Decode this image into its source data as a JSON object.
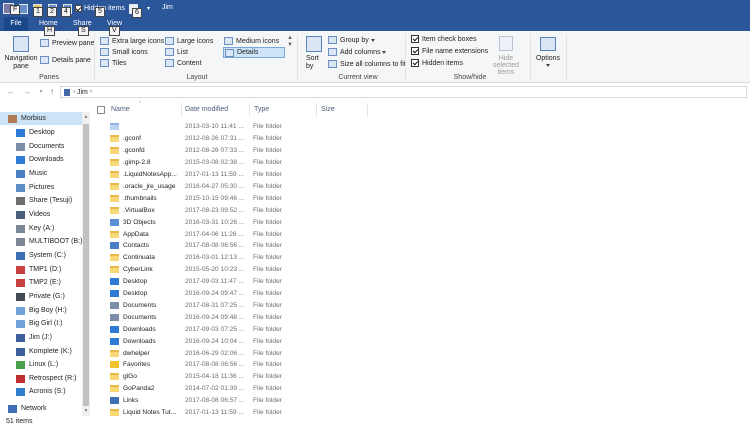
{
  "window": {
    "title": "Jim"
  },
  "quick_access": {
    "hidden_items_label": "Hidden items"
  },
  "keytips": {
    "file": "F",
    "qa1": "1",
    "qa2": "2",
    "qa4": "4",
    "qa5": "5",
    "qa6": "6",
    "home": "H",
    "share": "S",
    "view": "V"
  },
  "tabs": {
    "file": "File",
    "home": "Home",
    "share": "Share",
    "view": "View"
  },
  "ribbon": {
    "panes": {
      "label": "Panes",
      "navigation_pane": "Navigation pane",
      "preview_pane": "Preview pane",
      "details_pane": "Details pane"
    },
    "layout": {
      "label": "Layout",
      "extra_large_icons": "Extra large icons",
      "large_icons": "Large icons",
      "medium_icons": "Medium icons",
      "small_icons": "Small icons",
      "list": "List",
      "details": "Details",
      "tiles": "Tiles",
      "content": "Content"
    },
    "current_view": {
      "label": "Current view",
      "sort_by": "Sort by",
      "group_by": "Group by",
      "add_columns": "Add columns",
      "size_all_columns": "Size all columns to fit"
    },
    "show_hide": {
      "label": "Show/hide",
      "item_check_boxes": "Item check boxes",
      "file_name_extensions": "File name extensions",
      "hidden_items": "Hidden items",
      "hide_selected_items": "Hide selected items"
    },
    "options": {
      "label": "Options"
    }
  },
  "address": {
    "path": "Jim"
  },
  "navpane": {
    "items": [
      "Morbius",
      "Desktop",
      "Documents",
      "Downloads",
      "Music",
      "Pictures",
      "Share (Tesuji)",
      "Videos",
      "Key (A:)",
      "MULTIBOOT (B:)",
      "System (C:)",
      "TMP1 (D:)",
      "TMP2 (E:)",
      "Private (G:)",
      "Big Boy (H:)",
      "Big Girl (I:)",
      "Jim (J:)",
      "Komplete (K:)",
      "Linux (L:)",
      "Retrospect (R:)",
      "Acronis (S:)",
      "Network"
    ]
  },
  "columns": {
    "name": "Name",
    "date_modified": "Date modified",
    "type": "Type",
    "size": "Size"
  },
  "files": [
    {
      "name": "",
      "date": "2013-03-10 11:41 ...",
      "type": "File folder"
    },
    {
      "name": ".gconf",
      "date": "2012-08-26 07:31 ...",
      "type": "File folder"
    },
    {
      "name": ".gconfd",
      "date": "2012-08-26 07:33 ...",
      "type": "File folder"
    },
    {
      "name": ".gimp-2.8",
      "date": "2015-03-08 02:38 ...",
      "type": "File folder"
    },
    {
      "name": ".LiquidNotesApp...",
      "date": "2017-01-13 11:59 ...",
      "type": "File folder"
    },
    {
      "name": ".oracle_jre_usage",
      "date": "2016-04-27 05:30 ...",
      "type": "File folder"
    },
    {
      "name": ".thumbnails",
      "date": "2015-10-15 09:46 ...",
      "type": "File folder"
    },
    {
      "name": ".VirtualBox",
      "date": "2017-08-23 09:52 ...",
      "type": "File folder"
    },
    {
      "name": "3D Objects",
      "date": "2016-03-31 10:26 ...",
      "type": "File folder"
    },
    {
      "name": "AppData",
      "date": "2017-04-06 11:26 ...",
      "type": "File folder"
    },
    {
      "name": "Contacts",
      "date": "2017-08-08 06:56 ...",
      "type": "File folder"
    },
    {
      "name": "Continuata",
      "date": "2016-03-01 12:13 ...",
      "type": "File folder"
    },
    {
      "name": "CyberLink",
      "date": "2015-05-20 10:23 ...",
      "type": "File folder"
    },
    {
      "name": "Desktop",
      "date": "2017-09-03 11:47 ...",
      "type": "File folder"
    },
    {
      "name": "Desktop",
      "date": "2016-09-24 09:47 ...",
      "type": "File folder"
    },
    {
      "name": "Documents",
      "date": "2017-08-31 07:25 ...",
      "type": "File folder"
    },
    {
      "name": "Documents",
      "date": "2016-09-24 09:48 ...",
      "type": "File folder"
    },
    {
      "name": "Downloads",
      "date": "2017-09-03 07:25 ...",
      "type": "File folder"
    },
    {
      "name": "Downloads",
      "date": "2016-09-24 10:04 ...",
      "type": "File folder"
    },
    {
      "name": "dwhelper",
      "date": "2016-06-29 02:06 ...",
      "type": "File folder"
    },
    {
      "name": "Favorites",
      "date": "2017-08-08 06:56 ...",
      "type": "File folder"
    },
    {
      "name": "glGo",
      "date": "2015-04-18 11:36 ...",
      "type": "File folder"
    },
    {
      "name": "GoPanda2",
      "date": "2014-07-02 01:39 ...",
      "type": "File folder"
    },
    {
      "name": "Links",
      "date": "2017-08-08 06:57 ...",
      "type": "File folder"
    },
    {
      "name": "Liquid Notes Tut...",
      "date": "2017-01-13 11:59 ...",
      "type": "File folder"
    }
  ],
  "status": {
    "item_count": "51 items"
  },
  "colors": {
    "titlebar": "#2b579a",
    "selection": "#cde4f7",
    "folder": "#f8d775"
  },
  "icons": [
    "drive-icon",
    "folder-icon",
    "desktop-icon",
    "download-icon",
    "music-icon",
    "pictures-icon",
    "network-icon",
    "checkbox-icon",
    "back-arrow-icon",
    "forward-arrow-icon",
    "up-arrow-icon"
  ]
}
